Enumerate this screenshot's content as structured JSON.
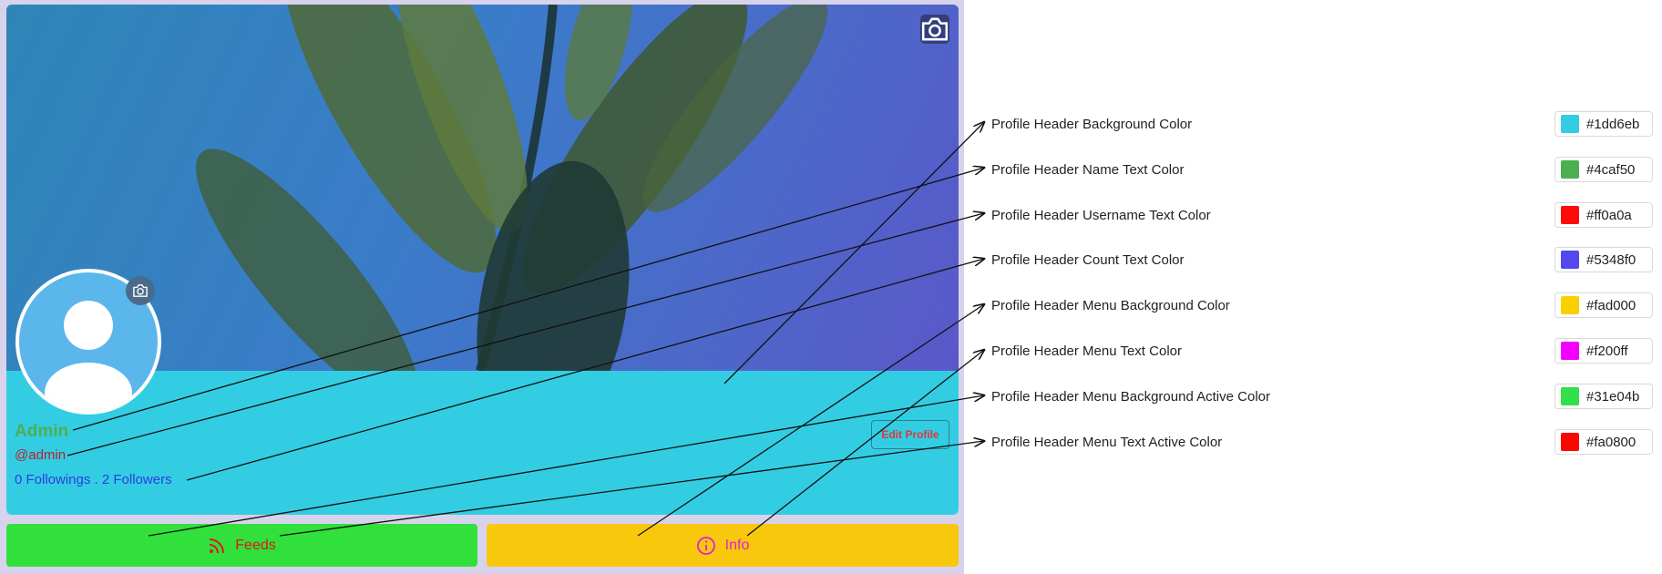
{
  "profile": {
    "name": "Admin",
    "username": "@admin",
    "counts": "0 Followings . 2 Followers",
    "edit_button_label": "Edit Profile"
  },
  "menu": {
    "feeds_label": "Feeds",
    "info_label": "Info"
  },
  "settings": [
    {
      "label": "Profile Header Background Color",
      "value": "#1dd6eb"
    },
    {
      "label": "Profile Header Name Text Color",
      "value": "#4caf50"
    },
    {
      "label": "Profile Header Username Text Color",
      "value": "#ff0a0a"
    },
    {
      "label": "Profile Header Count Text Color",
      "value": "#5348f0"
    },
    {
      "label": "Profile Header Menu Background Color",
      "value": "#fad000"
    },
    {
      "label": "Profile Header Menu Text Color",
      "value": "#f200ff"
    },
    {
      "label": "Profile Header Menu Background Active Color",
      "value": "#31e04b"
    },
    {
      "label": "Profile Header Menu Text Active Color",
      "value": "#fa0800"
    }
  ],
  "icons": {
    "cover_camera": "camera-icon",
    "avatar_camera": "camera-icon",
    "feeds": "rss-icon",
    "info": "info-circle-icon",
    "avatar": "user-silhouette-icon"
  }
}
